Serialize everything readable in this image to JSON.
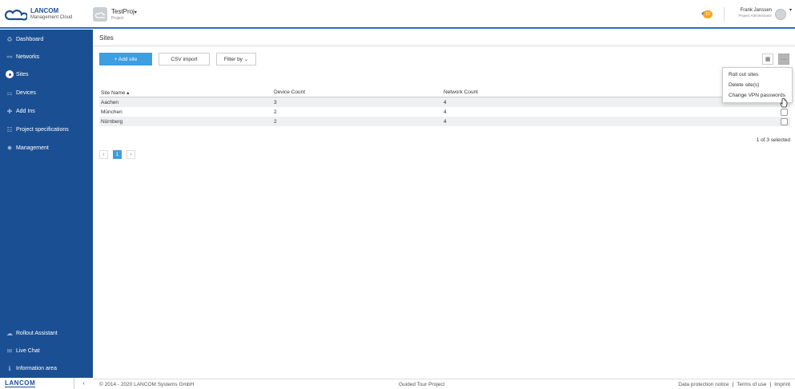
{
  "brand": {
    "name": "LANCOM",
    "sub": "Management Cloud"
  },
  "project": {
    "name": "TestProj",
    "caret": "▾",
    "label": "Project"
  },
  "header": {
    "badge": "10",
    "user_name": "Frank Janssen",
    "user_role": "Project Administrator",
    "user_caret": "▾"
  },
  "sidebar": {
    "items": [
      {
        "label": "Dashboard",
        "icon": "dashboard-icon",
        "glyph": "♻"
      },
      {
        "label": "Networks",
        "icon": "networks-icon",
        "glyph": "⚯"
      },
      {
        "label": "Sites",
        "icon": "location-pin-icon",
        "glyph": ""
      },
      {
        "label": "Devices",
        "icon": "devices-icon",
        "glyph": "⚏"
      },
      {
        "label": "Add Ins",
        "icon": "puzzle-icon",
        "glyph": "✚"
      },
      {
        "label": "Project specifications",
        "icon": "sliders-icon",
        "glyph": "☷"
      },
      {
        "label": "Management",
        "icon": "gear-icon",
        "glyph": "✹"
      }
    ],
    "bottom": [
      {
        "label": "Rollout Assistant",
        "icon": "rollout-icon",
        "glyph": "☁"
      },
      {
        "label": "Live Chat",
        "icon": "chat-icon",
        "glyph": "✉"
      },
      {
        "label": "Information area",
        "icon": "info-icon",
        "glyph": "ℹ"
      }
    ],
    "logo": "LANCOM",
    "collapse": "‹"
  },
  "page": {
    "title": "Sites"
  },
  "toolbar": {
    "add_site": "+ Add site",
    "csv_import": "CSV import",
    "filter_by": "Filter by ⌄",
    "grid_glyph": "▦",
    "more_glyph": "···"
  },
  "menu": {
    "items": [
      "Roll out sites",
      "Delete site(s)",
      "Change VPN passwords"
    ]
  },
  "table": {
    "headers": [
      "Site Name ▴",
      "Device Count",
      "Network Count"
    ],
    "rows": [
      {
        "name": "Aachen",
        "devices": "3",
        "networks": "4"
      },
      {
        "name": "München",
        "devices": "2",
        "networks": "4"
      },
      {
        "name": "Nürnberg",
        "devices": "2",
        "networks": "4"
      }
    ],
    "selected": "1 of 3 selected"
  },
  "pager": {
    "prev": "‹",
    "page": "1",
    "next": "›"
  },
  "footer": {
    "copyright": "© 2014 - 2020 LANCOM Systems GmbH",
    "tour": "Guided Tour Project",
    "privacy": "Data protection notice",
    "terms": "Terms of use",
    "imprint": "Imprint"
  },
  "colors": {
    "sidebar": "#1b4f93",
    "accent": "#3d9ee0",
    "badge": "#f5a623"
  }
}
